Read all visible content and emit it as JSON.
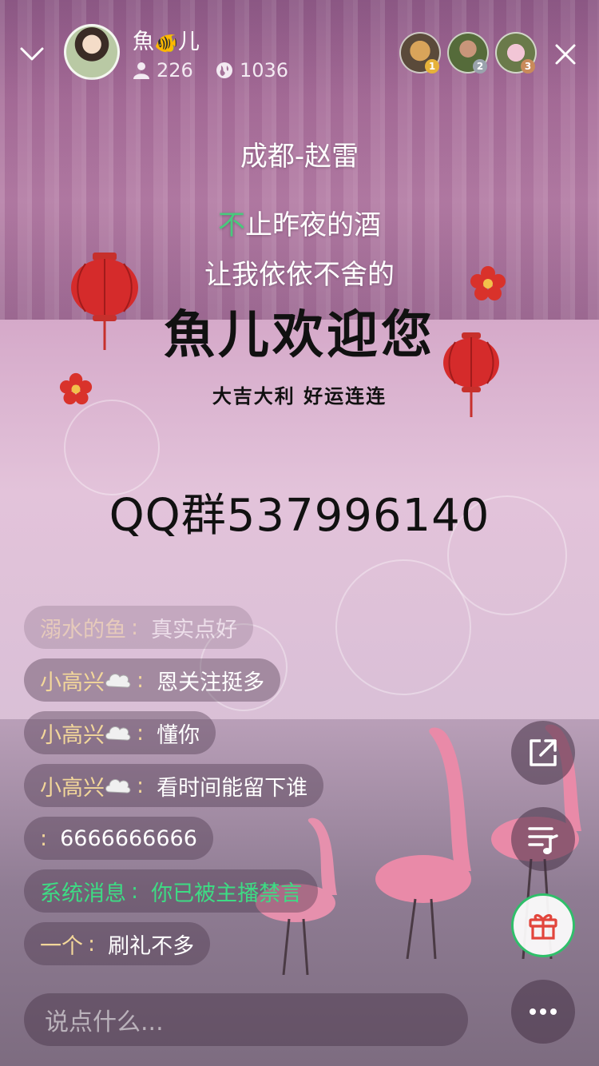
{
  "header": {
    "host_name": "魚",
    "host_name_suffix": "儿",
    "host_name_emoji": "🐠",
    "fans_count": "226",
    "heat_count": "1036",
    "top_viewers": [
      {
        "rank": "1",
        "rank_color": "#e6b23a"
      },
      {
        "rank": "2",
        "rank_color": "#9aa3ad"
      },
      {
        "rank": "3",
        "rank_color": "#c98a5a"
      }
    ]
  },
  "song": {
    "title": "成都-赵雷",
    "lyric_1_highlight": "不",
    "lyric_1_rest": "止昨夜的酒",
    "lyric_2": "让我依依不舍的"
  },
  "banner": {
    "welcome": "魚儿欢迎您",
    "blessing": "大吉大利  好运连连",
    "qq_group": "QQ群537996140"
  },
  "chat": [
    {
      "name": "溺水的鱼",
      "message": "真实点好",
      "faded": true,
      "bubble": false
    },
    {
      "name": "小高兴",
      "message": "恩关注挺多",
      "faded": false,
      "bubble": true
    },
    {
      "name": "小高兴",
      "message": "懂你",
      "faded": false,
      "bubble": true
    },
    {
      "name": "小高兴",
      "message": "看时间能留下谁",
      "faded": false,
      "bubble": true
    },
    {
      "name": "",
      "message": "6666666666",
      "faded": false,
      "bubble": false
    },
    {
      "name": "系统消息",
      "message": "你已被主播禁言",
      "faded": false,
      "bubble": false,
      "system": true
    },
    {
      "name": "一个",
      "message": "刷礼不多",
      "faded": false,
      "bubble": false
    }
  ],
  "chat_separator": ":",
  "input": {
    "placeholder": "说点什么..."
  },
  "colors": {
    "system_message": "#3ddc84",
    "username": "#f3d79a",
    "gift_ring": "#2fbf6a",
    "lyric_highlight": "#49c97d"
  },
  "icons": [
    "chevron-down-icon",
    "person-icon",
    "heat-icon",
    "close-icon",
    "share-icon",
    "playlist-icon",
    "gift-icon",
    "more-icon"
  ]
}
